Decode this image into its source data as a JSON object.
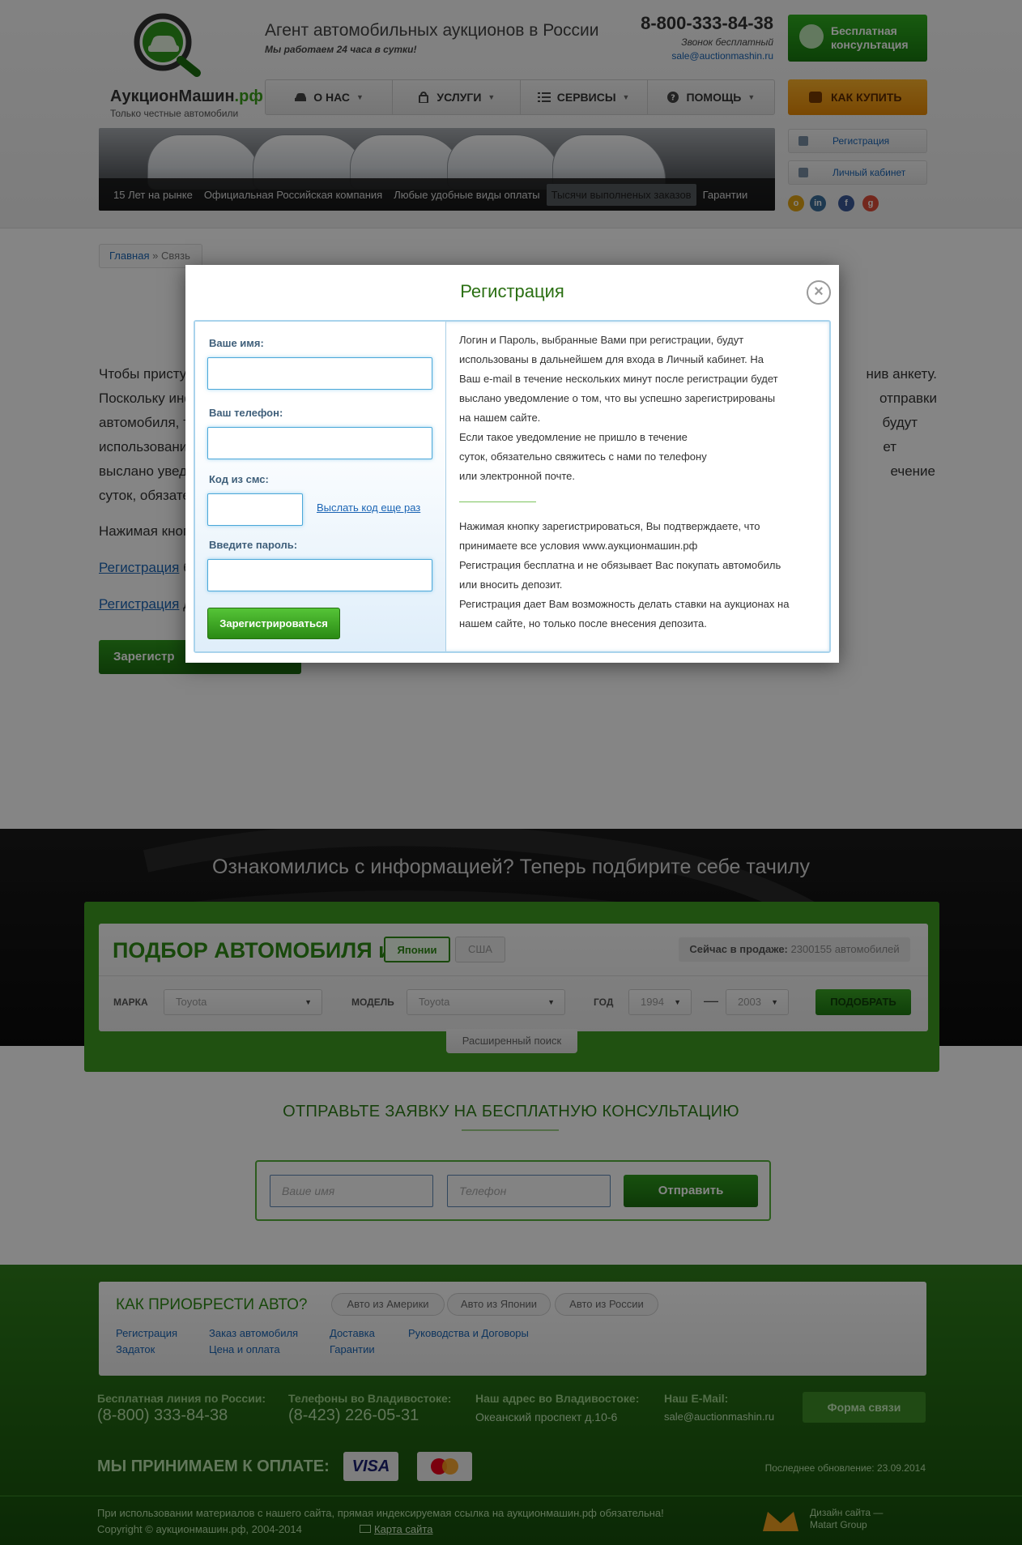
{
  "header": {
    "logo_text": "АукционМашин",
    "logo_suffix": ".рф",
    "logo_sub": "Только честные автомобили",
    "agent_title": "Агент автомобильных аукционов в России",
    "agent_sub": "Мы работаем 24 часа в сутки!",
    "phone": "8-800-333-84-38",
    "phone_note": "Звонок бесплатный",
    "email": "sale@auctionmashin.ru",
    "consult_btn": "Бесплатная консультация",
    "howbuy_btn": "КАК КУПИТЬ",
    "nav": [
      {
        "label": "О НАС",
        "icon": "car-icon"
      },
      {
        "label": "УСЛУГИ",
        "icon": "bag-icon"
      },
      {
        "label": "СЕРВИСЫ",
        "icon": "list-icon"
      },
      {
        "label": "ПОМОЩЬ",
        "icon": "help-icon"
      }
    ],
    "banner_items": [
      "15 Лет на рынке",
      "Официальная Российская компания",
      "Любые удобные виды оплаты",
      "Тысячи выполненых заказов",
      "Гарантии"
    ],
    "side_register": "Регистрация",
    "side_cabinet": "Личный кабинет"
  },
  "breadcrumb": {
    "home": "Главная",
    "sep": "»",
    "current": "Связь"
  },
  "content": {
    "para1_start": "Чтобы присту",
    "para1_end": "нив анкету.",
    "para2_start": "Поскольку инф",
    "para2_end": "отправки",
    "para3_start": "автомобиля, т",
    "para3_end": "будут",
    "para4_start": "использовани",
    "para4_end": "ет",
    "para5_start": "выслано увед",
    "para5_end": "ечение",
    "para6_start": "суток, обязате",
    "pressing": "Нажимая кноп",
    "reg_link1": "Регистрация",
    "reg_link1_rest": " б",
    "reg_link2": "Регистрация",
    "reg_link2_rest": " д",
    "register_btn": "Зарегистр"
  },
  "pick": {
    "banner_title": "Ознакомились с информацией? Теперь подбирите себе тачилу",
    "title": "ПОДБОР АВТОМОБИЛЯ из",
    "tab_japan": "Японии",
    "tab_usa": "США",
    "on_sale_label": "Сейчас в продаже:",
    "on_sale_value": "2300155 автомобилей",
    "make_label": "МАРКА",
    "make_value": "Toyota",
    "model_label": "МОДЕЛЬ",
    "model_value": "Toyota",
    "year_label": "ГОД",
    "year_from": "1994",
    "year_dash": "—",
    "year_to": "2003",
    "pick_btn": "ПОДОБРАТЬ",
    "advanced": "Расширенный поиск"
  },
  "consult": {
    "title": "ОТПРАВЬТЕ ЗАЯВКУ НА БЕСПЛАТНУЮ КОНСУЛЬТАЦИЮ",
    "name_placeholder": "Ваше имя",
    "phone_placeholder": "Телефон",
    "send_btn": "Отправить"
  },
  "footer": {
    "howto_title": "КАК ПРИОБРЕСТИ АВТО?",
    "howto_tabs": [
      "Авто из Америки",
      "Авто из Японии",
      "Авто из России"
    ],
    "links": [
      "Регистрация",
      "Заказ автомобиля",
      "Доставка",
      "Руководства и Договоры",
      "Задаток",
      "Цена и оплата",
      "Гарантии"
    ],
    "free_line_label": "Бесплатная линия по России:",
    "free_line": "(8-800) 333-84-38",
    "vl_phone_label": "Телефоны во Владивостоке:",
    "vl_phone": "(8-423) 226-05-31",
    "address_label": "Наш адрес во Владивостоке:",
    "address": "Океанский проспект д.10-6",
    "email_label": "Наш E-Mail:",
    "email": "sale@auctionmashin.ru",
    "feedback_btn": "Форма связи",
    "pay_title": "МЫ ПРИНИМАЕМ К ОПЛАТЕ:",
    "visa": "VISA",
    "updated": "Последнее обновление: 23.09.2014",
    "legal": "При использовании материалов с нашего сайта, прямая индексируемая ссылка на аукционмашин.рф обязательна!",
    "copyright": "Copyright © аукционмашин.рф, 2004-2014",
    "sitemap": "Карта сайта",
    "design": "Дизайн сайта —",
    "design_by": "Matart Group"
  },
  "modal": {
    "title": "Регистрация",
    "close": "×",
    "name_label": "Ваше имя:",
    "phone_label": "Ваш телефон:",
    "sms_label": "Код из смс:",
    "resend": "Выслать код еще раз",
    "password_label": "Введите пароль:",
    "submit": "Зарегистрироваться",
    "info_lines": [
      "Логин и Пароль, выбранные Вами при регистрации, будут",
      "использованы в дальнейшем для входа в Личный кабинет. На",
      "Ваш e-mail в течение нескольких минут после регистрации будет",
      "выслано уведомление о том, что вы успешно зарегистрированы",
      "на нашем сайте.",
      "Если такое уведомление не пришло в течение",
      "суток, обязательно свяжитесь с нами по телефону",
      "или электронной почте."
    ],
    "terms_lines": [
      "Нажимая кнопку зарегистрироваться, Вы подтверждаете, что",
      "принимаете все условия www.аукционмашин.рф",
      "Регистрация бесплатна и не обязывает Вас покупать автомобиль",
      "или вносить депозит.",
      "Регистрация дает Вам возможность делать ставки на аукционах на",
      "нашем сайте, но только после внесения депозита."
    ]
  },
  "colors": {
    "brand_green": "#2e8a16",
    "accent_orange": "#f0a020",
    "link_blue": "#1a64b4"
  }
}
